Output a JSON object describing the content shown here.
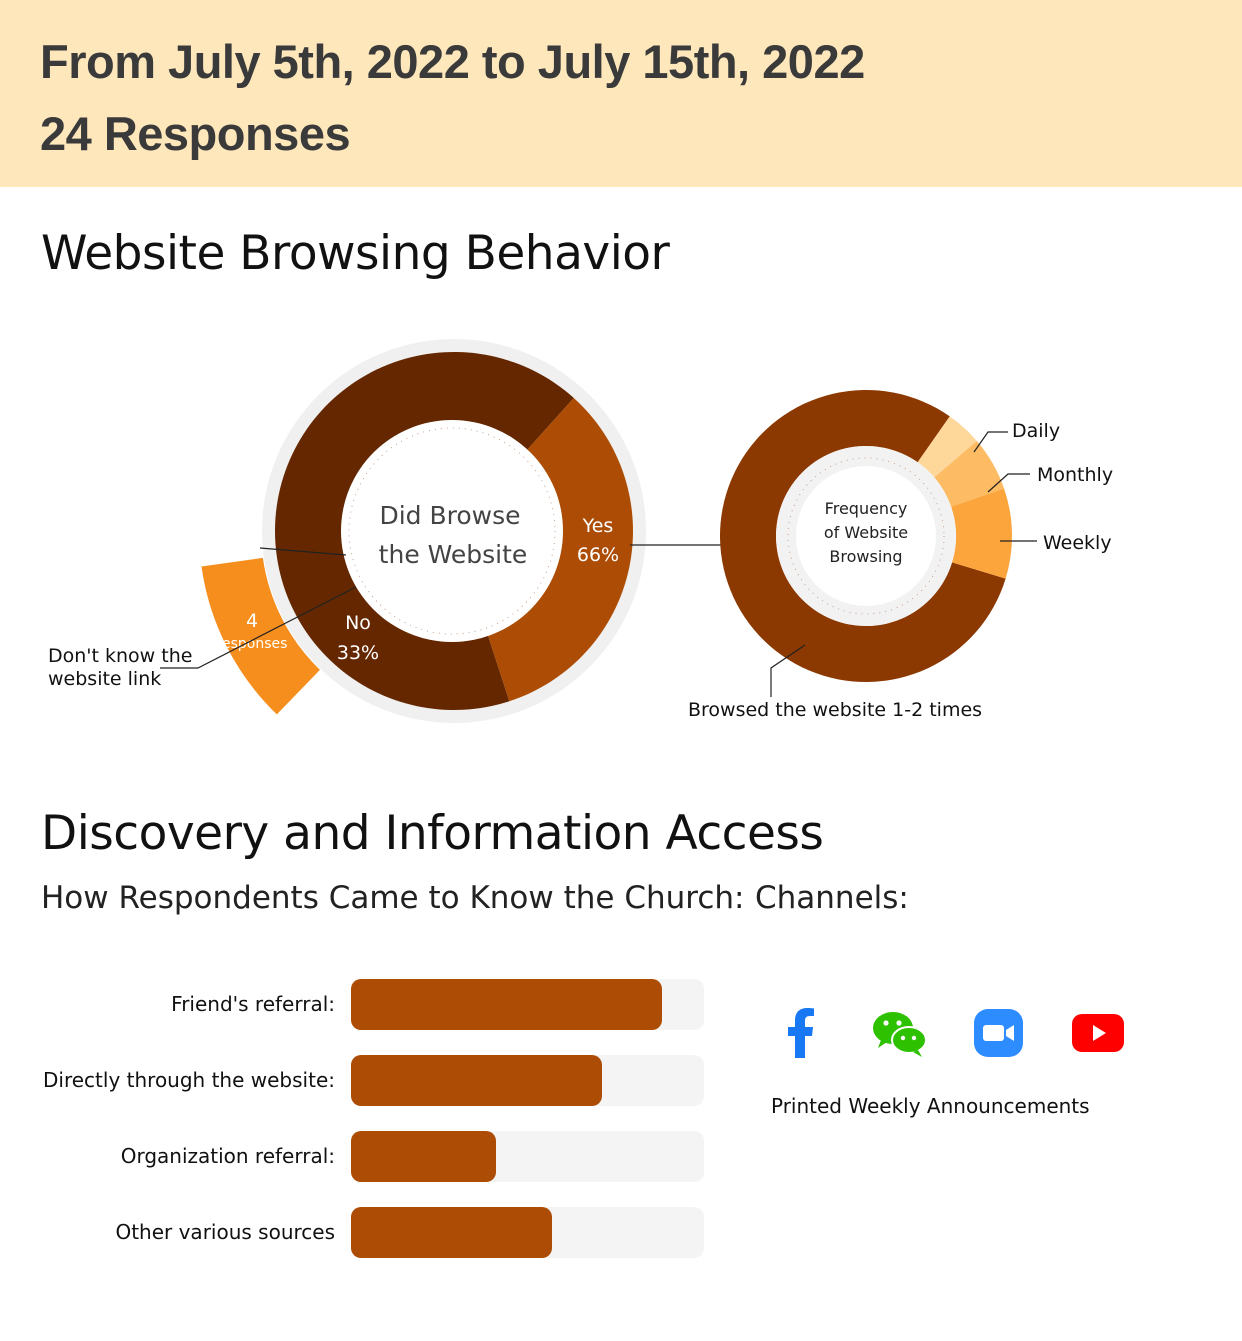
{
  "header": {
    "date_range": "From July 5th, 2022 to July 15th, 2022",
    "responses": "24 Responses"
  },
  "section1": {
    "title": "Website Browsing Behavior"
  },
  "section2": {
    "title": "Discovery and Information Access",
    "subtitle_left": "How Respondents Came to Know the Church:",
    "subtitle_right": "Channels:"
  },
  "chart_data": [
    {
      "type": "pie",
      "title": "Did Browse the Website",
      "categories": [
        "Yes",
        "No"
      ],
      "values": [
        66,
        33
      ],
      "labels": [
        {
          "name": "Yes",
          "value_text": "66%"
        },
        {
          "name": "No",
          "value_text": "33%"
        }
      ],
      "breakout": {
        "of": "No",
        "name": "Don't know the website link",
        "value_line1": "4",
        "value_line2": "responses",
        "value": 4
      },
      "colors": {
        "Yes": "#642700",
        "No": "#ad4d05",
        "breakout": "#f68e1e"
      }
    },
    {
      "type": "pie",
      "title": "Frequency of Website Browsing",
      "title_lines": [
        "Frequency",
        "of Website",
        "Browsing"
      ],
      "categories": [
        "Browsed the website 1-2 times",
        "Daily",
        "Monthly",
        "Weekly"
      ],
      "values": [
        80,
        4,
        6,
        10
      ],
      "colors": [
        "#8c3801",
        "#fed89a",
        "#fdbb63",
        "#fca53c"
      ]
    },
    {
      "type": "bar",
      "orientation": "horizontal",
      "categories": [
        "Friend's referral:",
        "Directly through the website:",
        "Organization referral:",
        "Other various sources"
      ],
      "values": [
        88,
        71,
        41,
        57
      ],
      "xlim": [
        0,
        100
      ],
      "color": "#ad4d05",
      "track_color": "#f4f4f4"
    }
  ],
  "channels": {
    "icons": [
      "facebook-icon",
      "wechat-icon",
      "zoom-icon",
      "youtube-icon"
    ],
    "colors": {
      "facebook": "#1877f2",
      "wechat": "#2dc100",
      "zoom": "#2d8cff",
      "youtube": "#ff0000"
    },
    "printed_label": "Printed Weekly Announcements"
  }
}
